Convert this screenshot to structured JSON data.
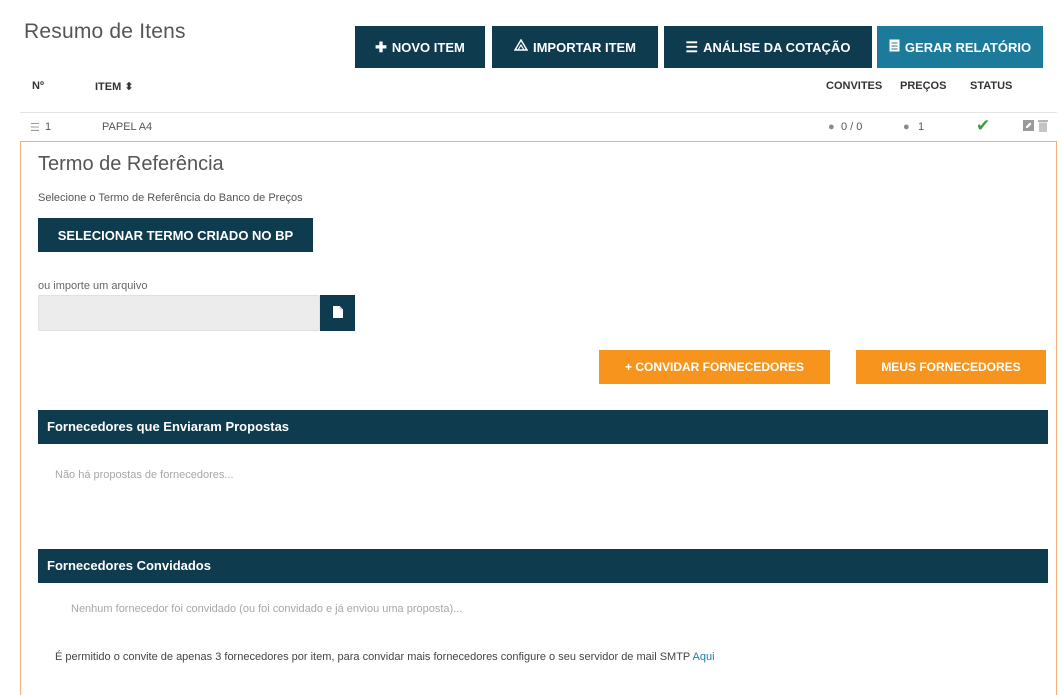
{
  "header": {
    "title": "Resumo de Itens",
    "buttons": {
      "new_item": "NOVO ITEM",
      "import_item": "IMPORTAR ITEM",
      "analysis": "ANÁLISE DA COTAÇÃO",
      "report": "GERAR RELATÓRIO"
    }
  },
  "table": {
    "headers": {
      "number": "Nº",
      "item": "ITEM ⬍",
      "invites": "CONVITES",
      "prices": "PREÇOS",
      "status": "STATUS"
    },
    "rows": [
      {
        "number": "1",
        "item": "PAPEL A4",
        "invites": "0 / 0",
        "prices": "1"
      }
    ]
  },
  "reference": {
    "title": "Termo de Referência",
    "subtitle": "Selecione o Termo de Referência do Banco de Preços",
    "select_button": "SELECIONAR TERMO CRIADO NO BP",
    "or_import": "ou importe um arquivo",
    "file_placeholder": ""
  },
  "actions": {
    "invite_suppliers": "+ CONVIDAR FORNECEDORES",
    "my_suppliers": "MEUS FORNECEDORES"
  },
  "proposals": {
    "title": "Fornecedores que Enviaram Propostas",
    "empty": "Não há propostas de fornecedores..."
  },
  "invited": {
    "title": "Fornecedores Convidados",
    "empty": "Nenhum fornecedor foi convidado (ou foi convidado e já enviou uma proposta)...",
    "note": "É permitido o convite de apenas 3 fornecedores por item, para convidar mais fornecedores configure o seu servidor de mail SMTP",
    "note_link": "Aqui"
  },
  "colors": {
    "navy": "#0f3b4f",
    "teal": "#1c7a9b",
    "orange": "#f7941d",
    "success": "#3f9b3f"
  },
  "icons": [
    "plus-icon",
    "import-icon",
    "list-icon",
    "document-icon",
    "sort-icon",
    "drag-handle-icon",
    "invite-count-icon",
    "price-count-icon",
    "check-icon",
    "edit-icon",
    "trash-icon",
    "file-icon"
  ]
}
